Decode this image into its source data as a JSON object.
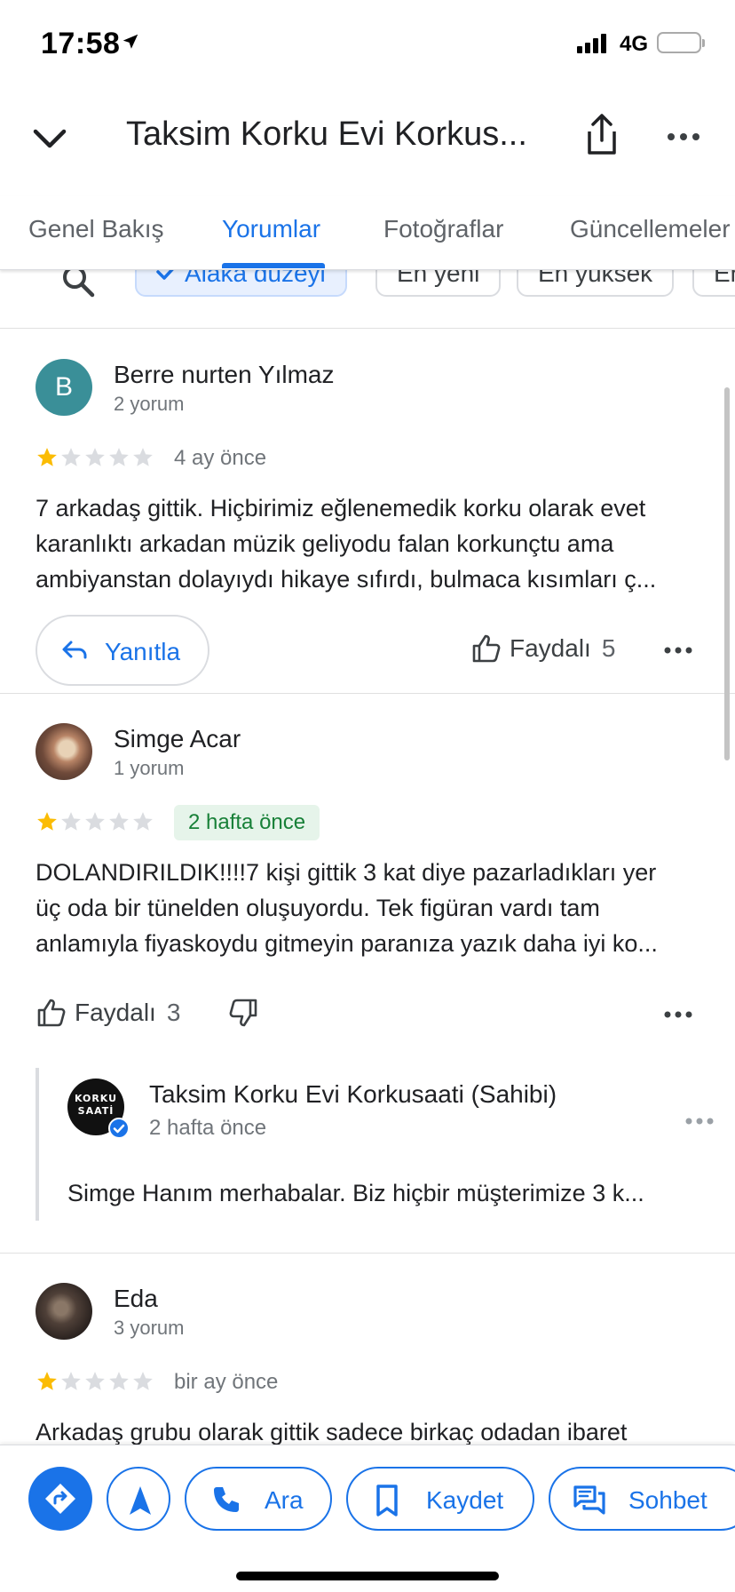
{
  "status_bar": {
    "time": "17:58",
    "network": "4G",
    "battery_level": 0.25
  },
  "header": {
    "title": "Taksim Korku Evi Korkus..."
  },
  "tabs": [
    {
      "label": "Genel Bakış",
      "active": false
    },
    {
      "label": "Yorumlar",
      "active": true
    },
    {
      "label": "Fotoğraflar",
      "active": false
    },
    {
      "label": "Güncellemeler",
      "active": false
    }
  ],
  "filters": [
    {
      "label": "Alaka düzeyi",
      "selected": true
    },
    {
      "label": "En yeni",
      "selected": false
    },
    {
      "label": "En yüksek",
      "selected": false
    },
    {
      "label": "En",
      "selected": false
    }
  ],
  "reviews": [
    {
      "avatar_letter": "B",
      "name": "Berre nurten Yılmaz",
      "review_count": "2 yorum",
      "rating": 1,
      "date": "4 ay önce",
      "text_lines": [
        "7 arkadaş gittik. Hiçbirimiz eğlenemedik korku olarak evet",
        "karanlıktı arkadan müzik geliyodu falan korkunçtu ama",
        "ambiyanstan dolayıydı hikaye sıfırdı, bulmaca kısımları ç..."
      ],
      "reply_label": "Yanıtla",
      "helpful_label": "Faydalı",
      "helpful_count": "5"
    },
    {
      "name": "Simge Acar",
      "review_count": "1 yorum",
      "rating": 1,
      "date": "2 hafta önce",
      "text_lines": [
        "DOLANDIRILDIK!!!!7 kişi gittik 3 kat diye pazarladıkları yer",
        "üç oda bir tünelden oluşuyordu. Tek figüran vardı tam",
        "anlamıyla fiyaskoydu gitmeyin paranıza yazık daha iyi ko..."
      ],
      "helpful_label": "Faydalı",
      "helpful_count": "3",
      "owner_reply": {
        "logo_line1": "KORKU",
        "logo_line2": "SAATİ",
        "name": "Taksim Korku Evi Korkusaati (Sahibi)",
        "date": "2 hafta önce",
        "text": "Simge Hanım merhabalar. Biz hiçbir müşterimize 3 k..."
      }
    },
    {
      "name": "Eda",
      "review_count": "3 yorum",
      "rating": 1,
      "date": "bir ay önce",
      "text_lines": [
        "Arkadaş grubu olarak gittik sadece birkaç odadan ibaret"
      ]
    }
  ],
  "actions": [
    {
      "icon": "directions-icon"
    },
    {
      "icon": "navigate-icon"
    },
    {
      "icon": "phone-icon",
      "label": "Ara"
    },
    {
      "icon": "bookmark-icon",
      "label": "Kaydet"
    },
    {
      "icon": "chat-icon",
      "label": "Sohbet"
    }
  ],
  "colors": {
    "accent": "#1a73e8",
    "star": "#fbbc04",
    "star_empty": "#dadce0",
    "badge_bg": "#e6f4ea",
    "badge_text": "#188038",
    "avatar_b": "#3a8f98"
  }
}
